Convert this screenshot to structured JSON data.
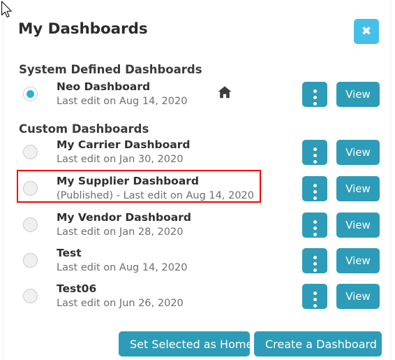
{
  "dialog": {
    "title": "My Dashboards",
    "close_label": "✖",
    "close_icon": "close-x-icon",
    "close_color": "#45c0e8"
  },
  "accent_color": "#2d9cb8",
  "highlight_color": "#f50000",
  "sections": [
    {
      "id": "system",
      "heading": "System Defined Dashboards",
      "rows": [
        {
          "name": "Neo Dashboard",
          "meta": "Last edit on Aug 14, 2020",
          "selected": true,
          "is_home": true,
          "home_icon": "home-icon",
          "menu_icon": "kebab-menu-icon",
          "view_label": "View"
        }
      ]
    },
    {
      "id": "custom",
      "heading": "Custom Dashboards",
      "rows": [
        {
          "name": "My Carrier Dashboard",
          "meta": "Last edit on Jan 30, 2020",
          "selected": false,
          "is_home": false,
          "menu_icon": "kebab-menu-icon",
          "view_label": "View"
        },
        {
          "name": "My Supplier Dashboard",
          "meta": "(Published) - Last edit on Aug 14, 2020",
          "selected": false,
          "is_home": false,
          "highlighted": true,
          "menu_icon": "kebab-menu-icon",
          "view_label": "View"
        },
        {
          "name": "My Vendor Dashboard",
          "meta": "Last edit on Jan 28, 2020",
          "selected": false,
          "is_home": false,
          "menu_icon": "kebab-menu-icon",
          "view_label": "View"
        },
        {
          "name": "Test",
          "meta": "Last edit on Aug 14, 2020",
          "selected": false,
          "is_home": false,
          "menu_icon": "kebab-menu-icon",
          "view_label": "View"
        },
        {
          "name": "Test06",
          "meta": "Last edit on Jun 26, 2020",
          "selected": false,
          "is_home": false,
          "menu_icon": "kebab-menu-icon",
          "view_label": "View"
        }
      ]
    }
  ],
  "footer": {
    "set_home_label": "Set Selected as Home",
    "create_label": "Create a Dashboard"
  },
  "cursor": {
    "icon": "mouse-pointer-icon"
  }
}
